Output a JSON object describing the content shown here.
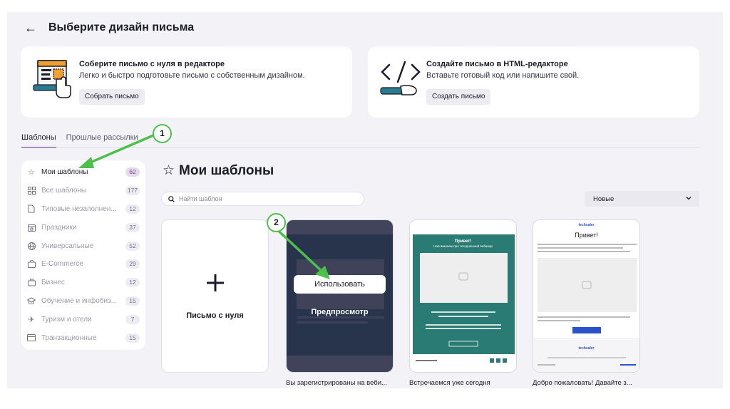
{
  "header": {
    "back_icon": "arrow-left-icon",
    "title": "Выберите дизайн письма"
  },
  "cards": [
    {
      "title": "Соберите письмо с нуля в редакторе",
      "description": "Легко и быстро подготовьте письмо с собственным дизайном.",
      "button": "Собрать письмо"
    },
    {
      "title": "Создайте письмо в HTML-редакторе",
      "description": "Вставьте готовый код или напишите свой.",
      "button": "Создать письмо"
    }
  ],
  "tabs": [
    {
      "label": "Шаблоны",
      "active": true
    },
    {
      "label": "Прошлые рассылки",
      "active": false
    }
  ],
  "sidebar": {
    "items": [
      {
        "label": "Мои шаблоны",
        "count": "62",
        "icon": "star-icon",
        "active": true
      },
      {
        "label": "Все шаблоны",
        "count": "177",
        "icon": "grid-icon"
      },
      {
        "label": "Типовые незаполнен...",
        "count": "12",
        "icon": "document-icon"
      },
      {
        "label": "Праздники",
        "count": "37",
        "icon": "calendar-icon"
      },
      {
        "label": "Универсальные",
        "count": "52",
        "icon": "globe-icon"
      },
      {
        "label": "E-Commerce",
        "count": "29",
        "icon": "shopping-bag-icon"
      },
      {
        "label": "Бизнес",
        "count": "12",
        "icon": "briefcase-icon"
      },
      {
        "label": "Обучение и инфобиз...",
        "count": "15",
        "icon": "graduation-cap-icon"
      },
      {
        "label": "Туризм и отели",
        "count": "7",
        "icon": "plane-icon"
      },
      {
        "label": "Транзакционные",
        "count": "15",
        "icon": "credit-card-icon"
      }
    ]
  },
  "main": {
    "title": "Мои шаблоны",
    "search_placeholder": "Найти шаблон",
    "sort_value": "Новые",
    "new_tile_label": "Письмо с нуля",
    "templates": [
      {
        "title": "Вы зарегистрированы на веби...",
        "use_label": "Использовать",
        "preview_label": "Предпросмотр"
      },
      {
        "title": "Встречаемся уже сегодня",
        "mini_heading": "Привет!",
        "mini_subheading": "Напоминаем про сегодняшний вебинар"
      },
      {
        "title": "Добро пожаловать! Давайте з...",
        "mini_brand": "techsaler",
        "mini_heading": "Привет!"
      }
    ]
  },
  "annotations": [
    {
      "number": "1"
    },
    {
      "number": "2"
    }
  ],
  "colors": {
    "accent": "#7a3b9a",
    "teal": "#2a7b73",
    "annotation_green": "#4cc04a"
  }
}
